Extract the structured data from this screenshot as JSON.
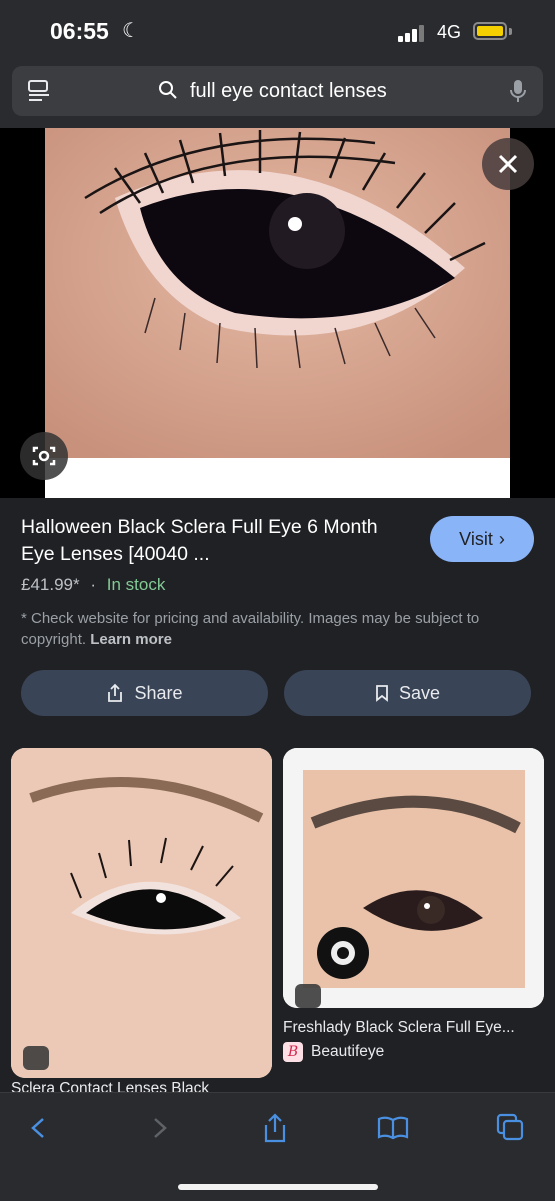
{
  "status": {
    "time": "06:55",
    "network": "4G"
  },
  "search": {
    "query": "full eye contact lenses"
  },
  "product": {
    "title": "Halloween Black Sclera Full Eye 6 Month Eye Lenses [40040 ...",
    "price": "£41.99*",
    "separator": "·",
    "stock": "In stock",
    "disclaimer": "* Check website for pricing and availability. Images may be subject to copyright.",
    "learn_more": "Learn more",
    "visit_label": "Visit"
  },
  "actions": {
    "share_label": "Share",
    "save_label": "Save"
  },
  "results": [
    {
      "title": "Sclera Contact Lenses Black"
    },
    {
      "title": "Freshlady Black Sclera Full Eye...",
      "source": "Beautifeye",
      "source_logo": "B"
    }
  ],
  "colors": {
    "accent": "#8ab4f8",
    "in_stock": "#81c995",
    "background": "#202124",
    "pill": "#394457"
  }
}
